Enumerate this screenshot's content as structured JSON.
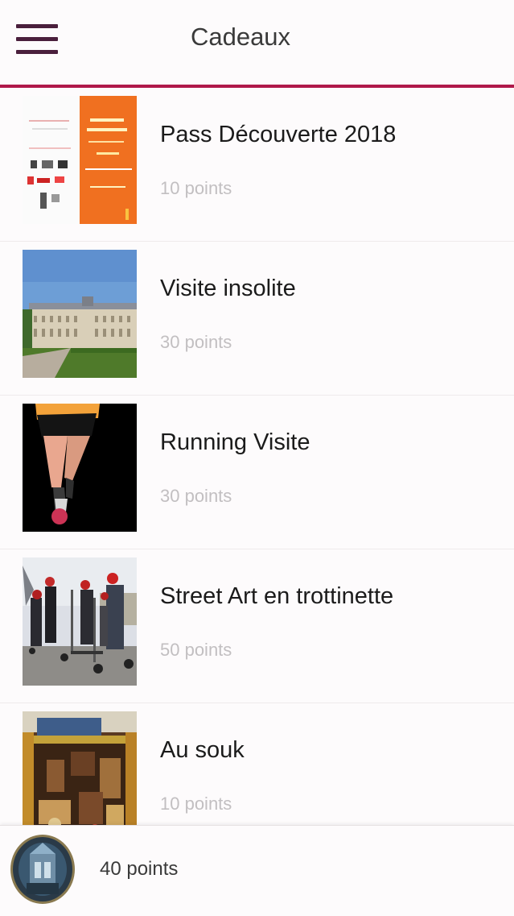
{
  "header": {
    "title": "Cadeaux",
    "menu_icon": "hamburger-menu-icon",
    "accent_color": "#b0184a"
  },
  "gifts": [
    {
      "title": "Pass Découverte 2018",
      "points": "10 points",
      "image": "pass-decouverte-poster-image"
    },
    {
      "title": "Visite insolite",
      "points": "30 points",
      "image": "chateau-building-photo"
    },
    {
      "title": "Running Visite",
      "points": "30 points",
      "image": "runner-legs-photo"
    },
    {
      "title": "Street Art en trottinette",
      "points": "50 points",
      "image": "scooter-group-photo"
    },
    {
      "title": "Au souk",
      "points": "10 points",
      "image": "souk-shop-photo"
    }
  ],
  "footer": {
    "user_points": "40 points",
    "avatar": "chapel-interior-avatar"
  }
}
